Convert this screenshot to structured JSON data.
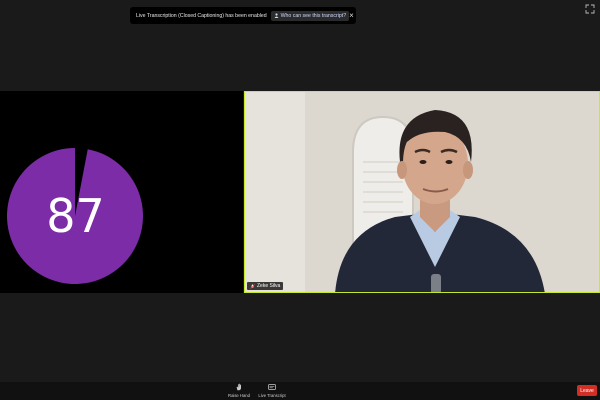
{
  "banner": {
    "message": "Live Transcription (Closed Captioning) has been enabled",
    "who_label": "Who can see this transcript?",
    "close_glyph": "×"
  },
  "timer": {
    "value": "87",
    "remaining_fraction": 0.97,
    "color": "#7b2ca6"
  },
  "participant": {
    "name": "Zeke Silva",
    "active_border_color": "#c8e830"
  },
  "toolbar": {
    "raise_hand_label": "Raise Hand",
    "live_transcript_label": "Live Transcript",
    "leave_label": "Leave",
    "leave_color": "#d12f25"
  }
}
